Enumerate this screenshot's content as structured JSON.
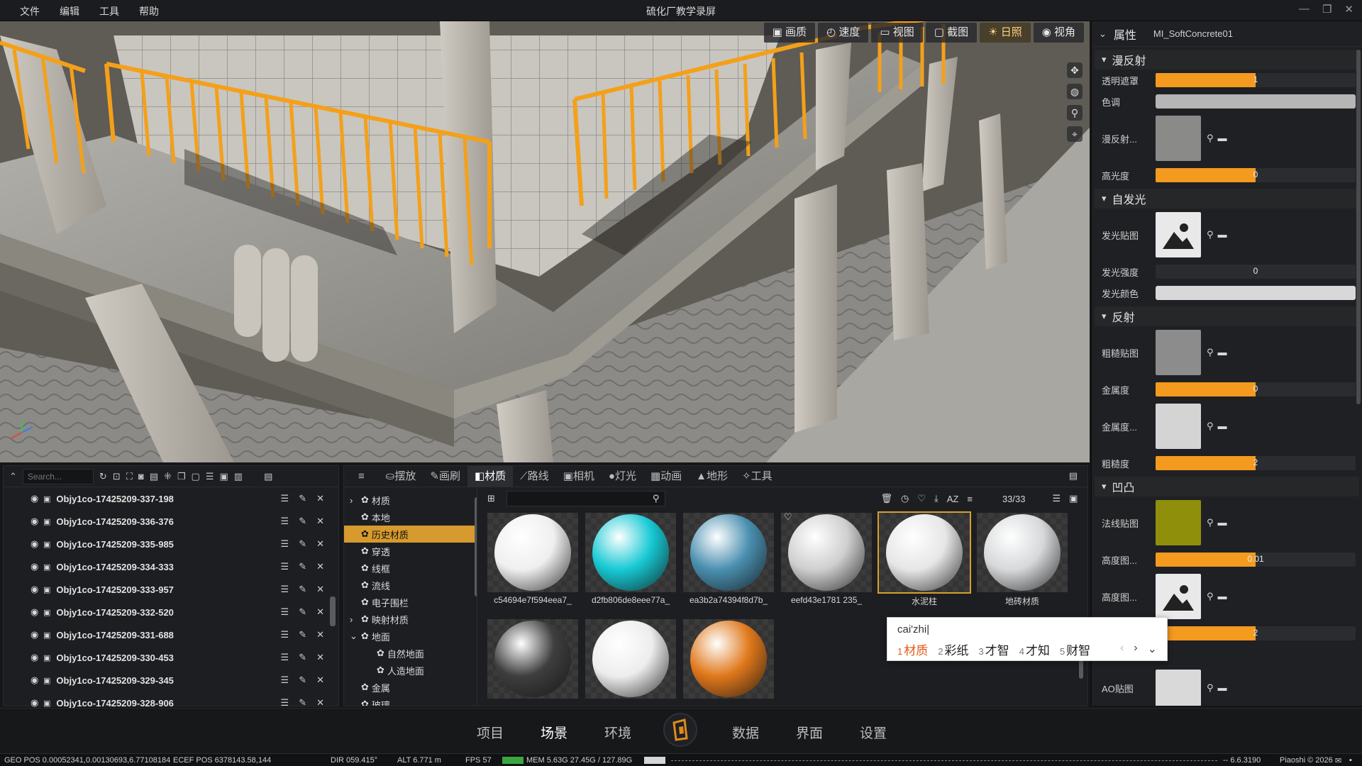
{
  "menu": [
    "文件",
    "编辑",
    "工具",
    "帮助"
  ],
  "window_title": "硫化厂教学录屏",
  "viewport_toolbar": [
    {
      "icon": "image-icon",
      "glyph": "▣",
      "label": "画质"
    },
    {
      "icon": "speed-icon",
      "glyph": "◴",
      "label": "速度"
    },
    {
      "icon": "camera-view-icon",
      "glyph": "▭",
      "label": "视图"
    },
    {
      "icon": "screenshot-icon",
      "glyph": "▢",
      "label": "截图"
    },
    {
      "icon": "sun-icon",
      "glyph": "☀",
      "label": "日照"
    },
    {
      "icon": "eye-icon",
      "glyph": "◉",
      "label": "视角"
    }
  ],
  "properties": {
    "title": "属性",
    "material_name": "MI_SoftConcrete01",
    "sections": {
      "diffuse": "漫反射",
      "emissive": "自发光",
      "reflection": "反射",
      "bump": "凹凸"
    },
    "rows": {
      "opacity_mask": {
        "label": "透明遮罩",
        "value": "1",
        "fraction": 0.5
      },
      "tint": {
        "label": "色调"
      },
      "diffuse_map": {
        "label": "漫反射..."
      },
      "specular": {
        "label": "高光度",
        "value": "0",
        "fraction": 0.5
      },
      "emissive_map": {
        "label": "发光贴图"
      },
      "emissive_intensity": {
        "label": "发光强度",
        "value": "0"
      },
      "emissive_color": {
        "label": "发光颜色"
      },
      "roughness_map": {
        "label": "粗糙贴图"
      },
      "metallic": {
        "label": "金属度",
        "value": "0",
        "fraction": 0.5
      },
      "metallic_map": {
        "label": "金属度..."
      },
      "roughness": {
        "label": "粗糙度",
        "value": "2",
        "fraction": 0.5
      },
      "normal_map": {
        "label": "法线贴图"
      },
      "height_value": {
        "label": "高度图...",
        "value": "0.01",
        "fraction": 0.5
      },
      "height_map": {
        "label": "高度图..."
      },
      "unnamed_value": {
        "value": "2",
        "fraction": 0.5
      },
      "ao_map": {
        "label": "AO贴图"
      }
    }
  },
  "outliner": {
    "search_placeholder": "Search...",
    "items": [
      "Objy1co-17425209-337-198",
      "Objy1co-17425209-336-376",
      "Objy1co-17425209-335-985",
      "Objy1co-17425209-334-333",
      "Objy1co-17425209-333-957",
      "Objy1co-17425209-332-520",
      "Objy1co-17425209-331-688",
      "Objy1co-17425209-330-453",
      "Objy1co-17425209-329-345",
      "Objy1co-17425209-328-906"
    ]
  },
  "asset_tabs": [
    {
      "icon": "menu-icon",
      "glyph": "≡",
      "label": ""
    },
    {
      "icon": "place-icon",
      "glyph": "⛀",
      "label": "摆放"
    },
    {
      "icon": "brush-icon",
      "glyph": "✎",
      "label": "画刷"
    },
    {
      "icon": "material-icon",
      "glyph": "◧",
      "label": "材质"
    },
    {
      "icon": "route-icon",
      "glyph": "⟋",
      "label": "路线"
    },
    {
      "icon": "camera-icon",
      "glyph": "▣",
      "label": "相机"
    },
    {
      "icon": "light-icon",
      "glyph": "●",
      "label": "灯光"
    },
    {
      "icon": "animation-icon",
      "glyph": "▦",
      "label": "动画"
    },
    {
      "icon": "terrain-icon",
      "glyph": "▲",
      "label": "地形"
    },
    {
      "icon": "tool-icon",
      "glyph": "✧",
      "label": "工具"
    }
  ],
  "tree": [
    {
      "label": "材质",
      "indent": 0,
      "arrow": "›"
    },
    {
      "label": "本地",
      "indent": 0,
      "arrow": ""
    },
    {
      "label": "历史材质",
      "indent": 0,
      "arrow": "",
      "selected": true
    },
    {
      "label": "穿透",
      "indent": 0,
      "arrow": ""
    },
    {
      "label": "线框",
      "indent": 0,
      "arrow": ""
    },
    {
      "label": "流线",
      "indent": 0,
      "arrow": ""
    },
    {
      "label": "电子围栏",
      "indent": 0,
      "arrow": ""
    },
    {
      "label": "映射材质",
      "indent": 0,
      "arrow": "›"
    },
    {
      "label": "地面",
      "indent": 0,
      "arrow": "⌄"
    },
    {
      "label": "自然地面",
      "indent": 1,
      "arrow": ""
    },
    {
      "label": "人造地面",
      "indent": 1,
      "arrow": ""
    },
    {
      "label": "金属",
      "indent": 0,
      "arrow": ""
    },
    {
      "label": "玻璃",
      "indent": 0,
      "arrow": ""
    }
  ],
  "asset_count": "33/33",
  "materials": [
    {
      "name": "c54694e7f594eea7_",
      "color": "#efefef"
    },
    {
      "name": "d2fb806de8eee77a_",
      "color": "#17c9d4"
    },
    {
      "name": "ea3b2a74394f8d7b_",
      "color": "#4a8fb0"
    },
    {
      "name": "eefd43e1781 235_",
      "color": "#cfcfcf"
    },
    {
      "name": "水泥柱",
      "color": "#e6e6e6",
      "selected": true
    },
    {
      "name": "地砖材质",
      "color": "#d6d8da"
    },
    {
      "name": "",
      "color": "#3e3e3e"
    },
    {
      "name": "",
      "color": "#ededed"
    },
    {
      "name": "",
      "color": "#e0781b"
    }
  ],
  "ime": {
    "composition": "cai'zhi",
    "candidates": [
      {
        "num": "1",
        "text": "材质"
      },
      {
        "num": "2",
        "text": "彩纸"
      },
      {
        "num": "3",
        "text": "才智"
      },
      {
        "num": "4",
        "text": "才知"
      },
      {
        "num": "5",
        "text": "财智"
      }
    ]
  },
  "main_tabs": [
    "项目",
    "场景",
    "环境",
    "数据",
    "界面",
    "设置"
  ],
  "main_tab_active": "场景",
  "status": {
    "geo": "GEO POS  0.00052341,0.00130693,6.77108184",
    "ecef": "ECEF POS  6378143.58,144",
    "dir": "DIR  059.415°",
    "alt": "ALT  6.771 m",
    "fps": "FPS  57",
    "mem": "MEM  5.63G  27.45G / 127.89G",
    "version": "-- 6.6.3190",
    "copyright": "Piaoshi © 2026"
  }
}
